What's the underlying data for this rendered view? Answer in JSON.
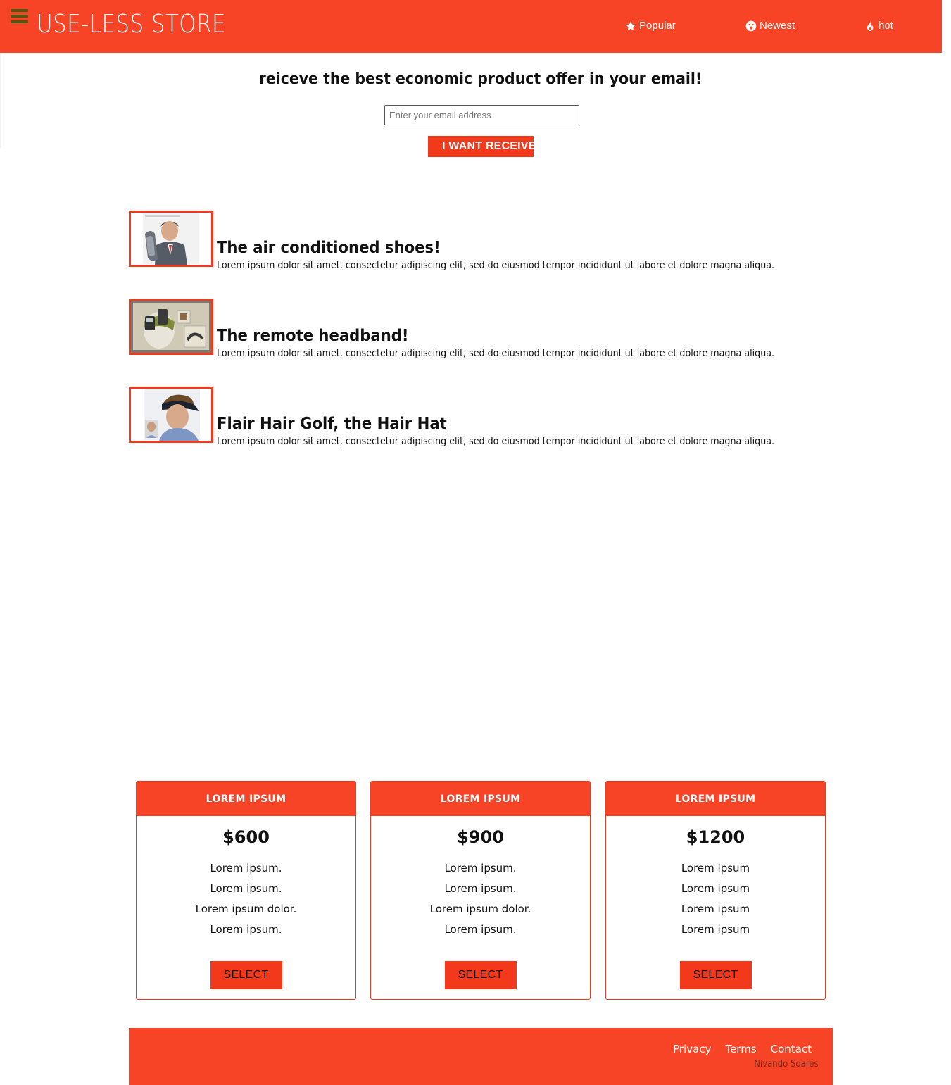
{
  "header": {
    "brand": "USE-LESS STORE",
    "menu_icon": "hamburger-menu-icon",
    "nav": [
      {
        "label": "Popular",
        "icon": "star-icon"
      },
      {
        "label": "Newest",
        "icon": "surprised-face-icon"
      },
      {
        "label": "hot",
        "icon": "fire-icon"
      }
    ]
  },
  "newsletter": {
    "title": "reiceve the best economic product offer in your email!",
    "email_placeholder": "Enter your email address",
    "email_value": "",
    "button_label": "I WANT RECEIVE"
  },
  "products": [
    {
      "title": "The air conditioned shoes!",
      "description": "Lorem ipsum dolor sit amet, consectetur adipiscing elit, sed do eiusmod tempor incididunt ut labore et dolore magna aliqua."
    },
    {
      "title": "The remote headband!",
      "description": "Lorem ipsum dolor sit amet, consectetur adipiscing elit, sed do eiusmod tempor incididunt ut labore et dolore magna aliqua."
    },
    {
      "title": "Flair Hair Golf, the Hair Hat",
      "description": "Lorem ipsum dolor sit amet, consectetur adipiscing elit, sed do eiusmod tempor incididunt ut labore et dolore magna aliqua."
    }
  ],
  "pricing": [
    {
      "header": "LOREM IPSUM",
      "price": "$600",
      "features": [
        "Lorem ipsum.",
        "Lorem ipsum.",
        "Lorem ipsum dolor.",
        "Lorem ipsum."
      ],
      "button": "SELECT"
    },
    {
      "header": "LOREM IPSUM",
      "price": "$900",
      "features": [
        "Lorem ipsum.",
        "Lorem ipsum.",
        "Lorem ipsum dolor.",
        "Lorem ipsum."
      ],
      "button": "SELECT"
    },
    {
      "header": "LOREM IPSUM",
      "price": "$1200",
      "features": [
        "Lorem ipsum",
        "Lorem ipsum",
        "Lorem ipsum",
        "Lorem ipsum"
      ],
      "button": "SELECT"
    }
  ],
  "footer": {
    "links": [
      "Privacy",
      "Terms",
      "Contact"
    ],
    "credit": "Nivando Soares"
  },
  "colors": {
    "brand": "#f74326",
    "button": "#f2391c",
    "border": "#ee3a1f"
  }
}
